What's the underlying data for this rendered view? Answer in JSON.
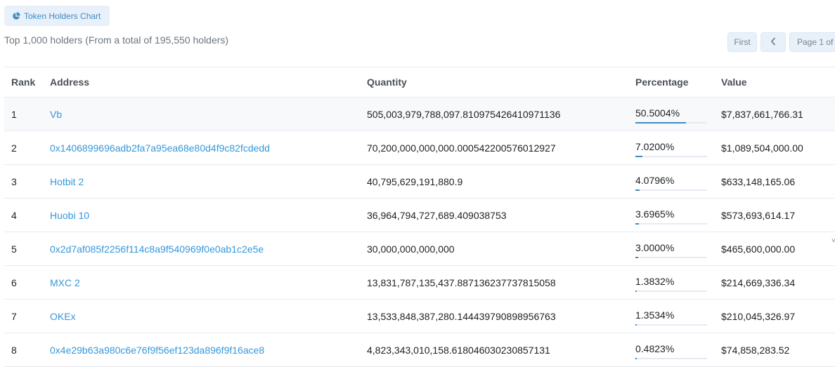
{
  "chart_button": {
    "label": "Token Holders Chart",
    "icon": "pie-chart-icon"
  },
  "summary": "Top 1,000 holders (From a total of 195,550 holders)",
  "pager": {
    "first_label": "First",
    "prev_icon": "chevron-left-icon",
    "page_label": "Page 1 of"
  },
  "table": {
    "headers": {
      "rank": "Rank",
      "address": "Address",
      "quantity": "Quantity",
      "percentage": "Percentage",
      "value": "Value"
    },
    "rows": [
      {
        "rank": "1",
        "address": "Vb",
        "quantity": "505,003,979,788,097.810975426410971136",
        "percentage": "50.5004%",
        "pct_value": 50.5004,
        "value": "$7,837,661,766.31"
      },
      {
        "rank": "2",
        "address": "0x1406899696adb2fa7a95ea68e80d4f9c82fcdedd",
        "quantity": "70,200,000,000,000.000542200576012927",
        "percentage": "7.0200%",
        "pct_value": 7.02,
        "value": "$1,089,504,000.00"
      },
      {
        "rank": "3",
        "address": "Hotbit 2",
        "quantity": "40,795,629,191,880.9",
        "percentage": "4.0796%",
        "pct_value": 4.0796,
        "value": "$633,148,165.06"
      },
      {
        "rank": "4",
        "address": "Huobi 10",
        "quantity": "36,964,794,727,689.409038753",
        "percentage": "3.6965%",
        "pct_value": 3.6965,
        "value": "$573,693,614.17"
      },
      {
        "rank": "5",
        "address": "0x2d7af085f2256f114c8a9f540969f0e0ab1c2e5e",
        "quantity": "30,000,000,000,000",
        "percentage": "3.0000%",
        "pct_value": 3.0,
        "value": "$465,600,000.00"
      },
      {
        "rank": "6",
        "address": "MXC 2",
        "quantity": "13,831,787,135,437.887136237737815058",
        "percentage": "1.3832%",
        "pct_value": 1.3832,
        "value": "$214,669,336.34"
      },
      {
        "rank": "7",
        "address": "OKEx",
        "quantity": "13,533,848,387,280.144439790898956763",
        "percentage": "1.3534%",
        "pct_value": 1.3534,
        "value": "$210,045,326.97"
      },
      {
        "rank": "8",
        "address": "0x4e29b63a980c6e76f9f56ef123da896f9f16ace8",
        "quantity": "4,823,343,010,158.618046030230857131",
        "percentage": "0.4823%",
        "pct_value": 0.4823,
        "value": "$74,858,283.52"
      }
    ]
  },
  "colors": {
    "link": "#3498db",
    "accent": "#3e8bc4",
    "button_bg": "#e8f1f9",
    "border": "#e7eaf3"
  }
}
